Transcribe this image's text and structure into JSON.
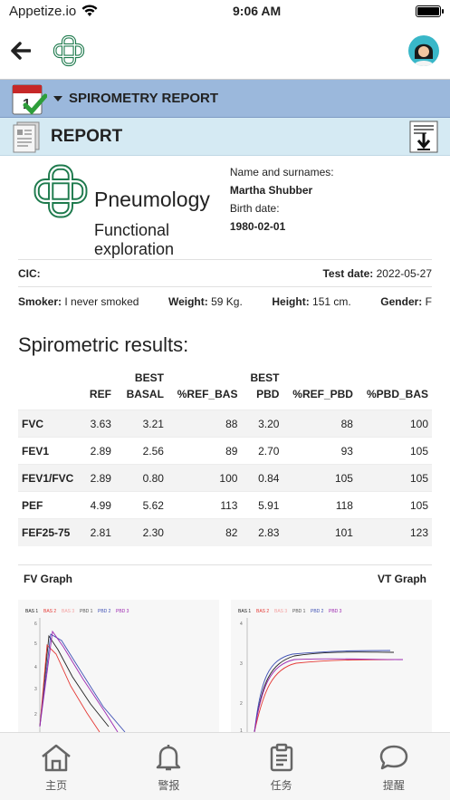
{
  "status_bar": {
    "carrier": "Appetize.io",
    "time": "9:06 AM"
  },
  "section_header": {
    "title": "SPIROMETRY REPORT"
  },
  "report_header": {
    "title": "REPORT"
  },
  "brand": {
    "name": "Pneumology",
    "subtitle": "Functional exploration"
  },
  "patient": {
    "name_label": "Name and surnames:",
    "name": "Martha Shubber",
    "birth_label": "Birth date:",
    "birth": "1980-02-01"
  },
  "info": {
    "cic_label": "CIC:",
    "test_date_label": "Test date:",
    "test_date": "2022-05-27",
    "smoker_label": "Smoker:",
    "smoker": "I never smoked",
    "weight_label": "Weight:",
    "weight": "59 Kg.",
    "height_label": "Height:",
    "height": "151 cm.",
    "gender_label": "Gender:",
    "gender": "F"
  },
  "results": {
    "title": "Spirometric results:",
    "columns": [
      "",
      "REF",
      "BEST BASAL",
      "%REF_BAS",
      "BEST PBD",
      "%REF_PBD",
      "%PBD_BAS"
    ],
    "rows": [
      [
        "FVC",
        "3.63",
        "3.21",
        "88",
        "3.20",
        "88",
        "100"
      ],
      [
        "FEV1",
        "2.89",
        "2.56",
        "89",
        "2.70",
        "93",
        "105"
      ],
      [
        "FEV1/FVC",
        "2.89",
        "0.80",
        "100",
        "0.84",
        "105",
        "105"
      ],
      [
        "PEF",
        "4.99",
        "5.62",
        "113",
        "5.91",
        "118",
        "105"
      ],
      [
        "FEF25-75",
        "2.81",
        "2.30",
        "82",
        "2.83",
        "101",
        "123"
      ]
    ]
  },
  "graphs": {
    "fv_title": "FV Graph",
    "vt_title": "VT Graph",
    "legend": [
      "BAS 1",
      "BAS 2",
      "BAS 3",
      "PBD 1",
      "PBD 2",
      "PBD 3"
    ],
    "fv_y_ticks": [
      "6",
      "5",
      "4",
      "3",
      "2"
    ],
    "vt_y_ticks": [
      "4",
      "3",
      "2",
      "1"
    ]
  },
  "tabbar": [
    {
      "label": "主页",
      "icon": "home-icon"
    },
    {
      "label": "警报",
      "icon": "bell-icon"
    },
    {
      "label": "任务",
      "icon": "clipboard-icon"
    },
    {
      "label": "提醒",
      "icon": "chat-bubble-icon"
    }
  ],
  "colors": {
    "section_blue": "#9bb8dc",
    "report_bar": "#d5eaf3",
    "logo_green": "#1e7a4d"
  }
}
